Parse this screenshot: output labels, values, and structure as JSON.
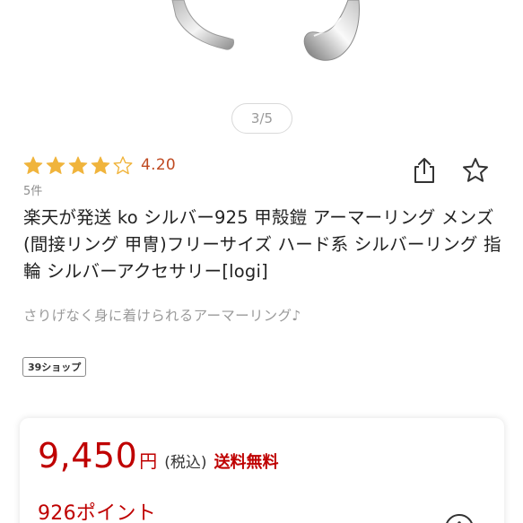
{
  "gallery": {
    "pager_text": "3/5",
    "image_icon": "silver-ring-photo"
  },
  "rating": {
    "value": "4.20",
    "stars_filled": 4,
    "stars_total": 5,
    "review_count": "5件",
    "star_color": "#f0b43c"
  },
  "actions": {
    "share_icon": "share-icon",
    "favorite_icon": "star-outline-icon"
  },
  "product": {
    "title": "楽天が発送 ko シルバー925 甲殻鎧 アーマーリング メンズ (間接リング 甲冑)フリーサイズ ハード系 シルバーリング 指輪 シルバーアクセサリー[logi]",
    "catchcopy": "さりげなく身に着けられるアーマーリング♪",
    "shop_badge": "39ショップ"
  },
  "price": {
    "amount": "9,450",
    "yen": "円",
    "tax_label": "(税込)",
    "shipping_label": "送料無料",
    "points": "926ポイント",
    "accent_color": "#bf0000"
  }
}
